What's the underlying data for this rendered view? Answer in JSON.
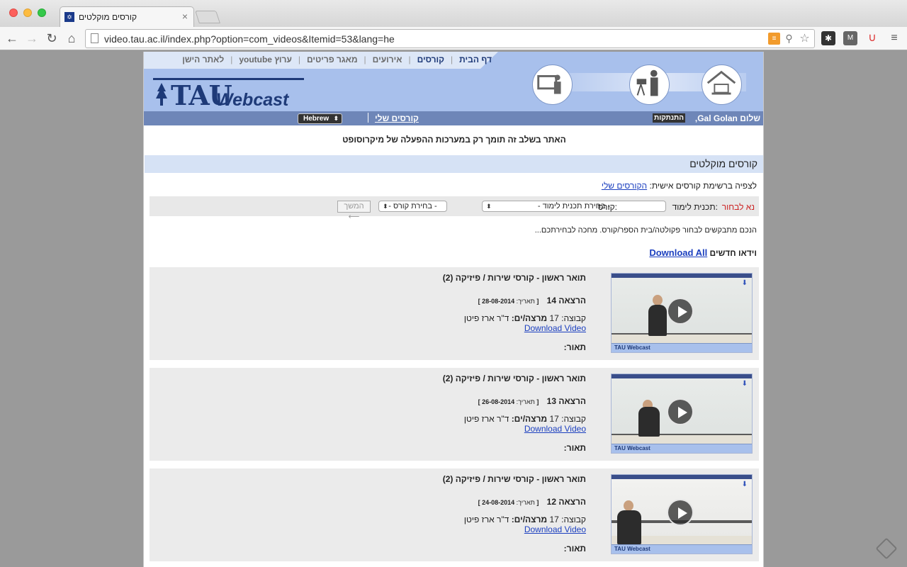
{
  "browser": {
    "tab_title": "קורסים מוקלטים",
    "favicon_text": "✡",
    "url": "video.tau.ac.il/index.php?option=com_videos&Itemid=53&lang=he"
  },
  "site": {
    "nav": [
      "דף הבית",
      "קורסים",
      "אירועים",
      "מאגר פריטים",
      "ערוץ youtube",
      "לאתר הישן"
    ],
    "logo_tau": "TAU",
    "logo_webcast": "Webcast",
    "greeting": "שלום Gal Golan,",
    "logout": "התנתקות",
    "my_courses": "קורסים שלי",
    "language": "Hebrew",
    "notice": "האתר בשלב זה תומך רק במערכות ההפעלה של מיקרוסופט",
    "section_title": "קורסים מוקלטים",
    "my_list_prefix": "לצפיה ברשימת קורסים אישית:",
    "my_list_link": "הקורסים שלי"
  },
  "filter": {
    "choose": "נא לבחור",
    "program_label": "תכנית לימוד:",
    "program_value": "- בחירת תכנית לימוד -",
    "course_label": "קורס:",
    "course_value": "- בחירת קורס -",
    "next_label": "המשך ⟵"
  },
  "hint": "הנכם מתבקשים לבחור פקולטה/בית הספר/קורס. מחכה לבחירתכם...",
  "new_videos": {
    "label": "וידאו חדשים",
    "download_all": "Download All"
  },
  "videos": [
    {
      "title": "תואר ראשון - קורסי שירות / פיזיקה (2)",
      "lecture": "הרצאה  14",
      "date_label": "תאריך:",
      "date": "28-08-2014",
      "group": "17",
      "lecturer": "ד\"ר ארז פיטן",
      "download": "Download Video",
      "desc": "תאור:",
      "thumb_footer": "TAU Webcast"
    },
    {
      "title": "תואר ראשון - קורסי שירות / פיזיקה (2)",
      "lecture": "הרצאה  13",
      "date_label": "תאריך:",
      "date": "26-08-2014",
      "group": "17",
      "lecturer": "ד\"ר ארז פיטן",
      "download": "Download Video",
      "desc": "תאור:",
      "thumb_footer": "TAU Webcast"
    },
    {
      "title": "תואר ראשון - קורסי שירות / פיזיקה (2)",
      "lecture": "הרצאה  12",
      "date_label": "תאריך:",
      "date": "24-08-2014",
      "group": "17",
      "lecturer": "ד\"ר ארז פיטן",
      "download": "Download Video",
      "desc": "תאור:",
      "thumb_footer": "TAU Webcast"
    }
  ],
  "labels": {
    "group": "קבוצה:",
    "lecturer": "מרצה/ים:"
  },
  "colors": {
    "banner": "#a8c0ec",
    "brand": "#1e3a78",
    "link": "#1b3fbf",
    "bluebar": "#6e86b8"
  }
}
